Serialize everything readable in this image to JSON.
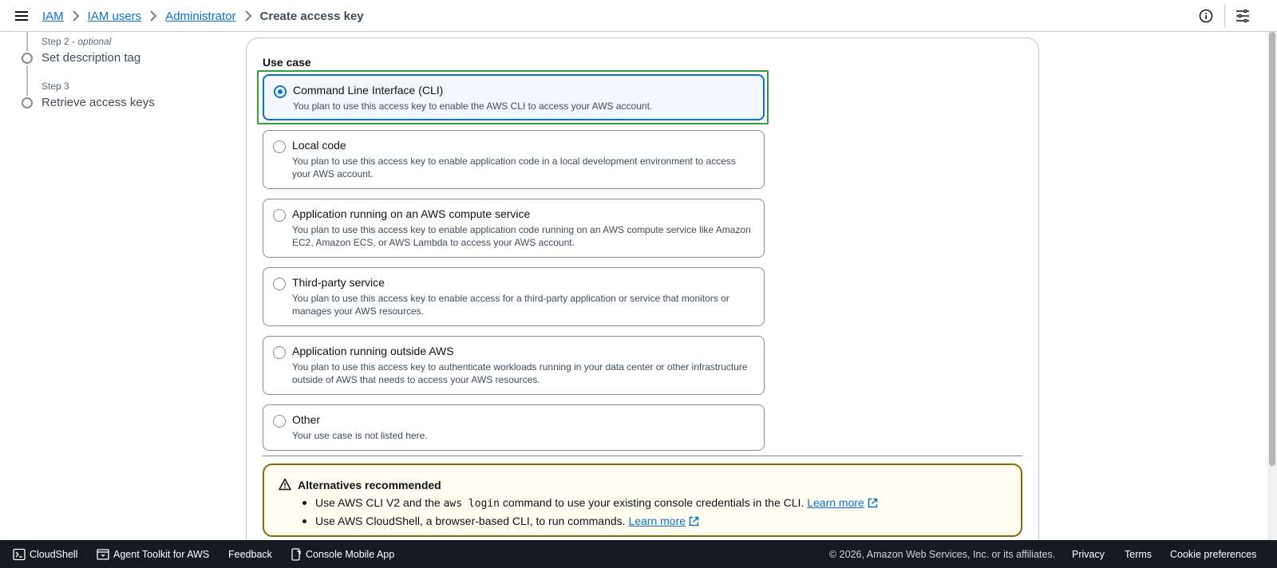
{
  "breadcrumb": {
    "items": [
      "IAM",
      "IAM users",
      "Administrator"
    ],
    "current": "Create access key"
  },
  "steps": {
    "step2_label": "Step 2",
    "step2_optional": "optional",
    "step2_title": "Set description tag",
    "step3_label": "Step 3",
    "step3_title": "Retrieve access keys"
  },
  "use_case": {
    "label": "Use case",
    "selected": "Command Line Interface (CLI)",
    "options": [
      {
        "title": "Command Line Interface (CLI)",
        "desc": "You plan to use this access key to enable the AWS CLI to access your AWS account."
      },
      {
        "title": "Local code",
        "desc": "You plan to use this access key to enable application code in a local development environment to access your AWS account."
      },
      {
        "title": "Application running on an AWS compute service",
        "desc": "You plan to use this access key to enable application code running on an AWS compute service like Amazon EC2, Amazon ECS, or AWS Lambda to access your AWS account."
      },
      {
        "title": "Third-party service",
        "desc": "You plan to use this access key to enable access for a third-party application or service that monitors or manages your AWS resources."
      },
      {
        "title": "Application running outside AWS",
        "desc": "You plan to use this access key to authenticate workloads running in your data center or other infrastructure outside of AWS that needs to access your AWS resources."
      },
      {
        "title": "Other",
        "desc": "Your use case is not listed here."
      }
    ]
  },
  "alert": {
    "title": "Alternatives recommended",
    "item1_pre": "Use AWS CLI V2 and the ",
    "item1_code": "aws login",
    "item1_post": " command to use your existing console credentials in the CLI.",
    "item2_text": "Use AWS CloudShell, a browser-based CLI, to run commands.",
    "learn_more": "Learn more"
  },
  "footer": {
    "cloudshell": "CloudShell",
    "agent_toolkit": "Agent Toolkit for AWS",
    "feedback": "Feedback",
    "mobile_app": "Console Mobile App",
    "copyright": "© 2026, Amazon Web Services, Inc. or its affiliates.",
    "privacy": "Privacy",
    "terms": "Terms",
    "cookie": "Cookie preferences"
  },
  "colors": {
    "link": "#0972d3",
    "selected_border": "#0972d3",
    "selected_bg": "#f2f8fd",
    "alert_border": "#8d6605",
    "alert_bg": "#fffef0",
    "footer_bg": "#16191f",
    "focus_ring": "#3a9b3a"
  }
}
